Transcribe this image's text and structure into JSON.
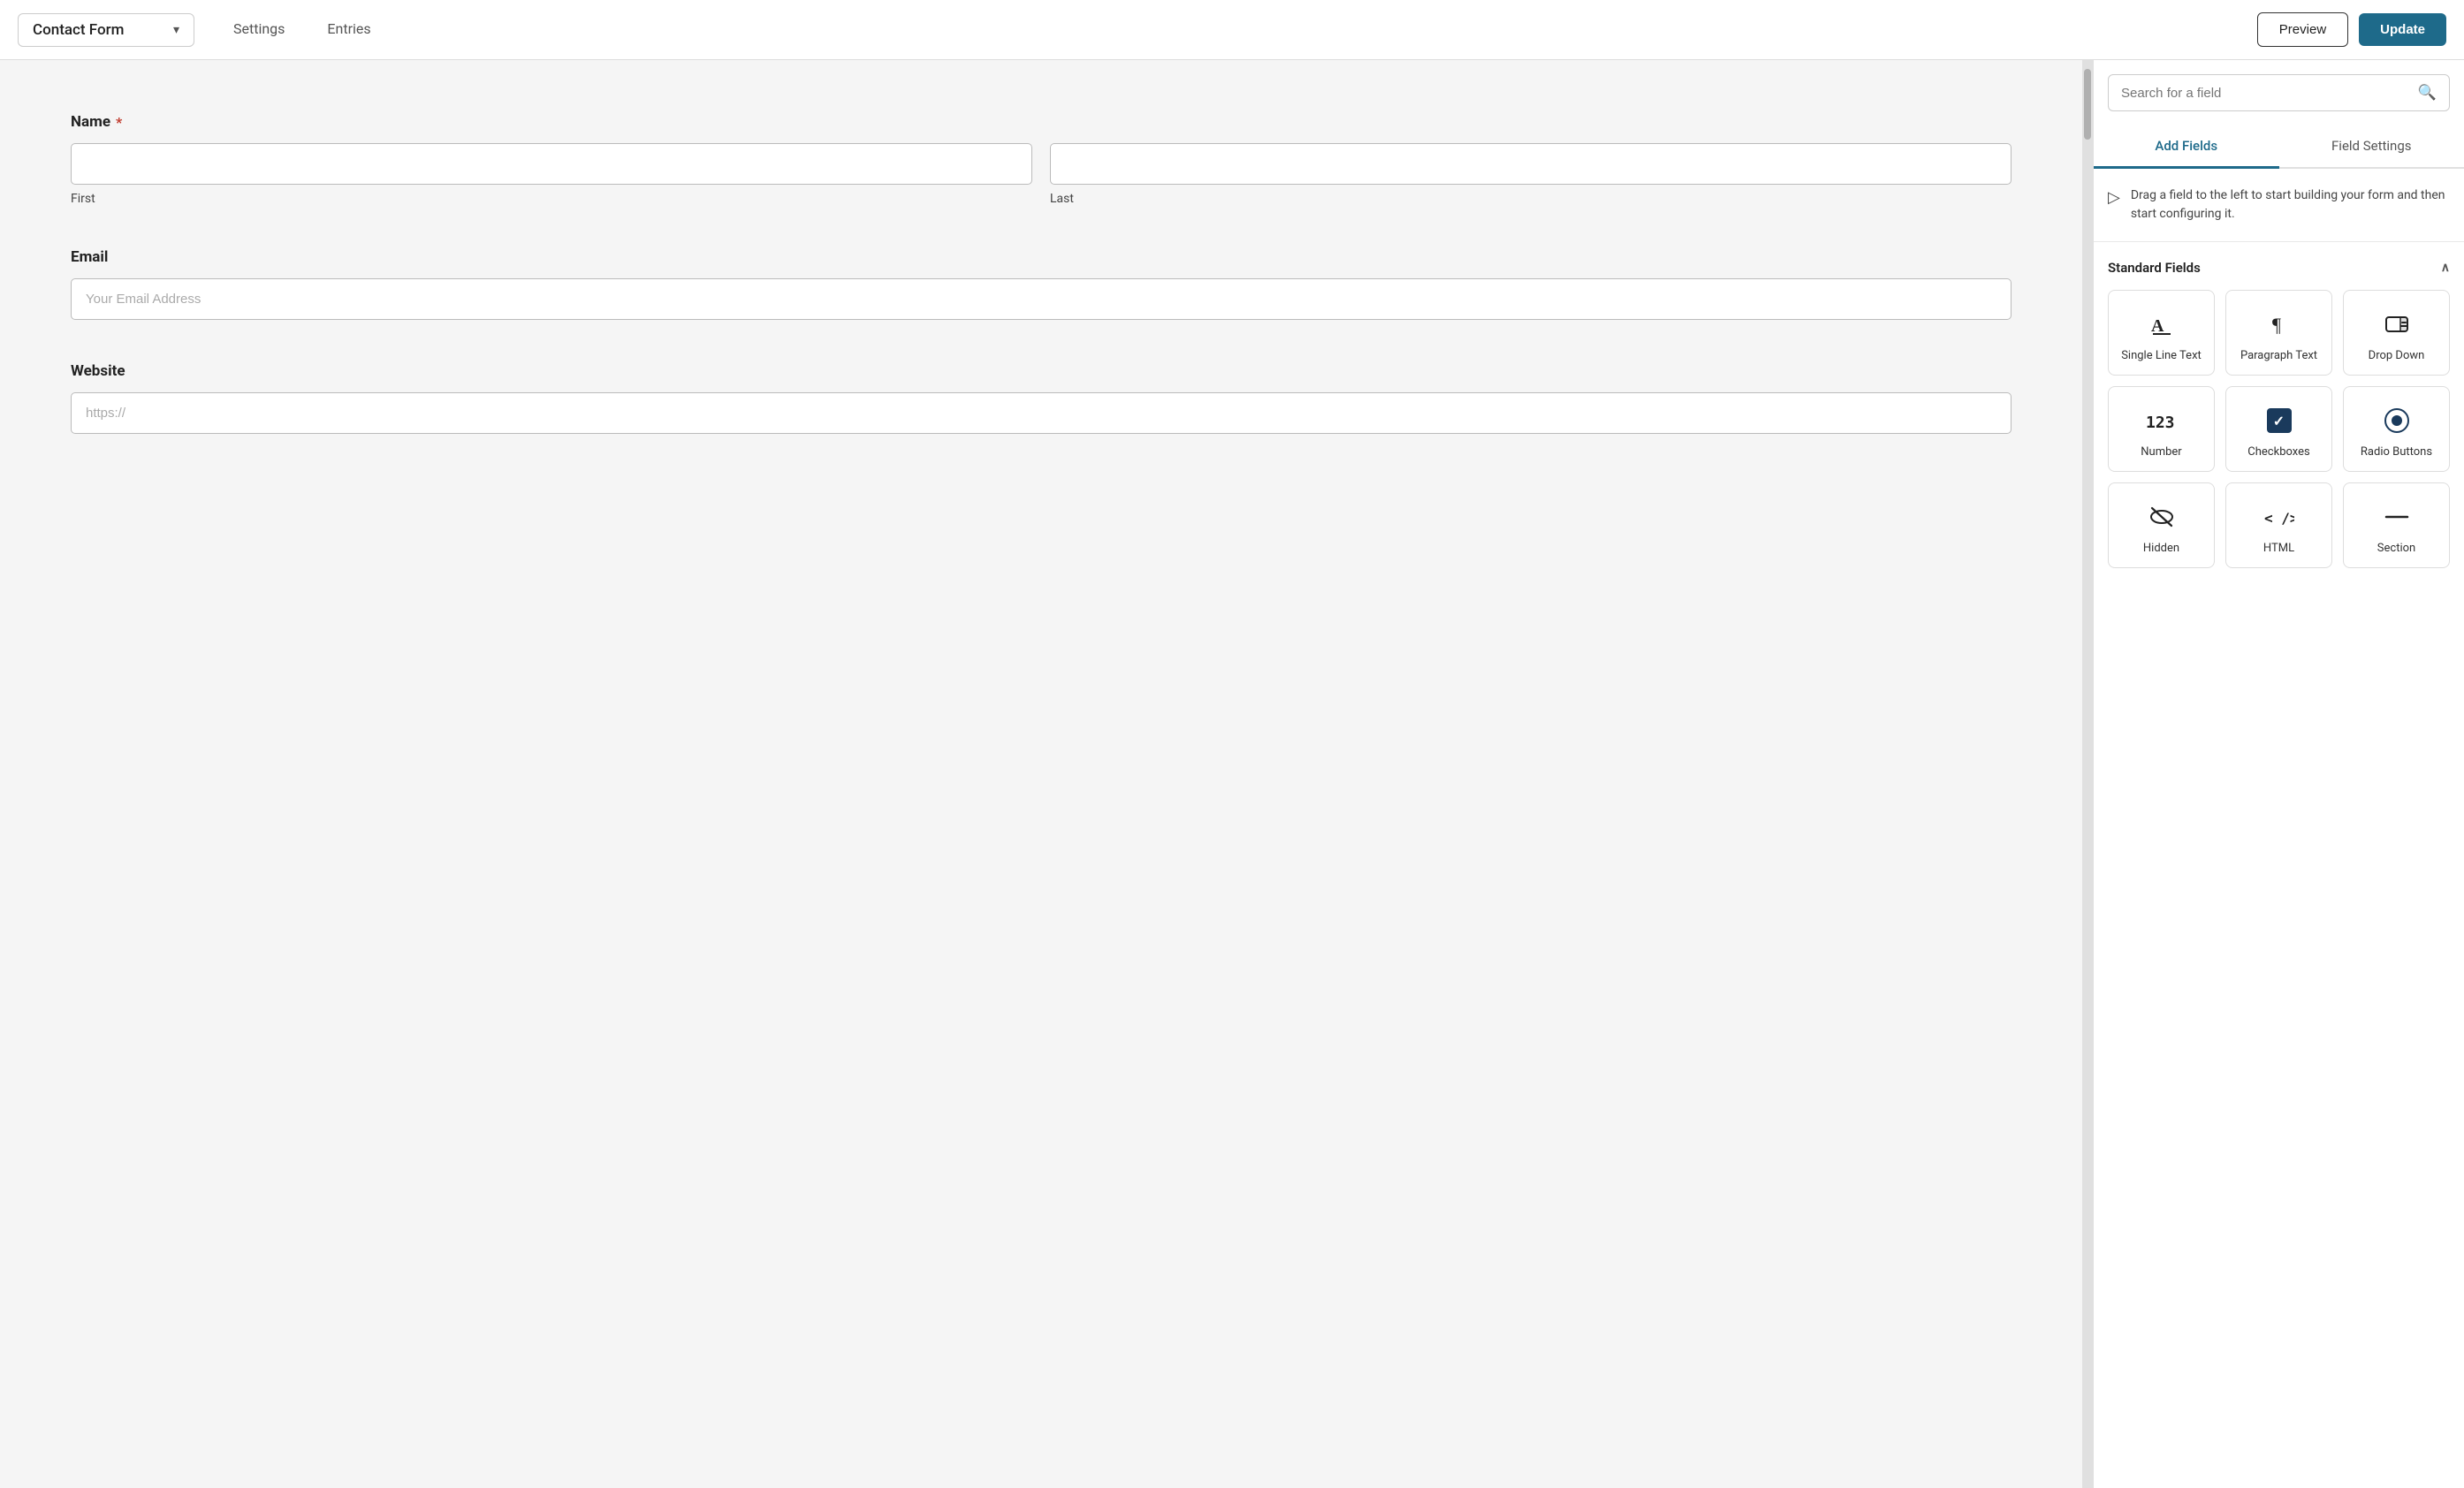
{
  "header": {
    "form_title": "Contact Form",
    "chevron": "▾",
    "nav_tabs": [
      {
        "id": "settings",
        "label": "Settings"
      },
      {
        "id": "entries",
        "label": "Entries"
      }
    ],
    "preview_label": "Preview",
    "update_label": "Update"
  },
  "search": {
    "placeholder": "Search for a field"
  },
  "panel_tabs": [
    {
      "id": "add-fields",
      "label": "Add Fields",
      "active": true
    },
    {
      "id": "field-settings",
      "label": "Field Settings",
      "active": false
    }
  ],
  "drag_hint": {
    "text": "Drag a field to the left to start building your form and then start configuring it."
  },
  "standard_fields": {
    "section_label": "Standard Fields",
    "fields": [
      {
        "id": "single-line-text",
        "label": "Single Line Text",
        "icon_type": "text"
      },
      {
        "id": "paragraph-text",
        "label": "Paragraph Text",
        "icon_type": "paragraph"
      },
      {
        "id": "drop-down",
        "label": "Drop Down",
        "icon_type": "dropdown"
      },
      {
        "id": "number",
        "label": "Number",
        "icon_type": "number"
      },
      {
        "id": "checkboxes",
        "label": "Checkboxes",
        "icon_type": "checkbox"
      },
      {
        "id": "radio-buttons",
        "label": "Radio Buttons",
        "icon_type": "radio"
      },
      {
        "id": "hidden",
        "label": "Hidden",
        "icon_type": "hidden"
      },
      {
        "id": "html",
        "label": "HTML",
        "icon_type": "html"
      },
      {
        "id": "section",
        "label": "Section",
        "icon_type": "section"
      }
    ]
  },
  "form": {
    "fields": [
      {
        "id": "name",
        "label": "Name",
        "required": true,
        "type": "name",
        "subfields": [
          {
            "placeholder": "",
            "sublabel": "First"
          },
          {
            "placeholder": "",
            "sublabel": "Last"
          }
        ]
      },
      {
        "id": "email",
        "label": "Email",
        "required": false,
        "type": "single",
        "placeholder": "Your Email Address"
      },
      {
        "id": "website",
        "label": "Website",
        "required": false,
        "type": "single",
        "placeholder": "https://"
      }
    ]
  }
}
